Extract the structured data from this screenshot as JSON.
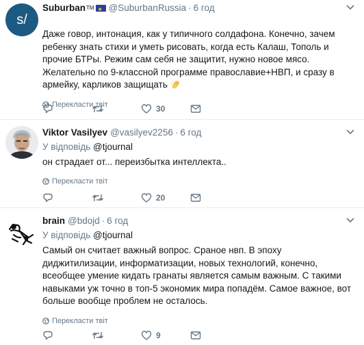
{
  "tweets": [
    {
      "fullname": "Suburban",
      "verified_mark": "TM",
      "username": "@SuburbanRussia",
      "dot": "·",
      "time": "6 год",
      "avatar_text": "s/",
      "text": "Даже говор, интонация, как у типичного солдафона. Конечно, зачем ребенку знать стихи и уметь рисовать, когда есть Калаш, Тополь и прочие БТРы. Режим сам себя не защитит, нужно новое мясо. Желательно по 9-классной программе православие+НВП, и сразу в армейку, карликов защищать",
      "translate_label": "Перекласти твіт",
      "likes": "30",
      "icons": [
        "reply-icon",
        "retweet-icon",
        "heart-icon",
        "mail-icon",
        "clapping-hands-emoji"
      ]
    },
    {
      "fullname": "Viktor Vasilyev",
      "username": "@vasilyev2256",
      "dot": "·",
      "time": "6 год",
      "reply_prefix": "У відповідь",
      "reply_mention": "@tjournal",
      "text": "он страдает от... переизбытка интеллекта..",
      "translate_label": "Перекласти твіт",
      "likes": "20"
    },
    {
      "fullname": "brain",
      "username": "@bdojd",
      "dot": "·",
      "time": "6 год",
      "reply_prefix": "У відповідь",
      "reply_mention": "@tjournal",
      "text": "Самый он считает важный вопрос. Сраное нвп. В эпоху диджитилизации, информатизации, новых технологий, конечно, всеобщее умение кидать гранаты является самым важным. С такими навыками уж точно в топ-5 экономик мира попадём. Самое важное, вот больше вообще проблем не осталось.",
      "translate_label": "Перекласти твіт",
      "likes": "9"
    }
  ],
  "colors": {
    "secondary_text": "#657786",
    "primary_text": "#14171a",
    "border": "#e6ecf0",
    "avatar_blue": "#1d5a83"
  }
}
